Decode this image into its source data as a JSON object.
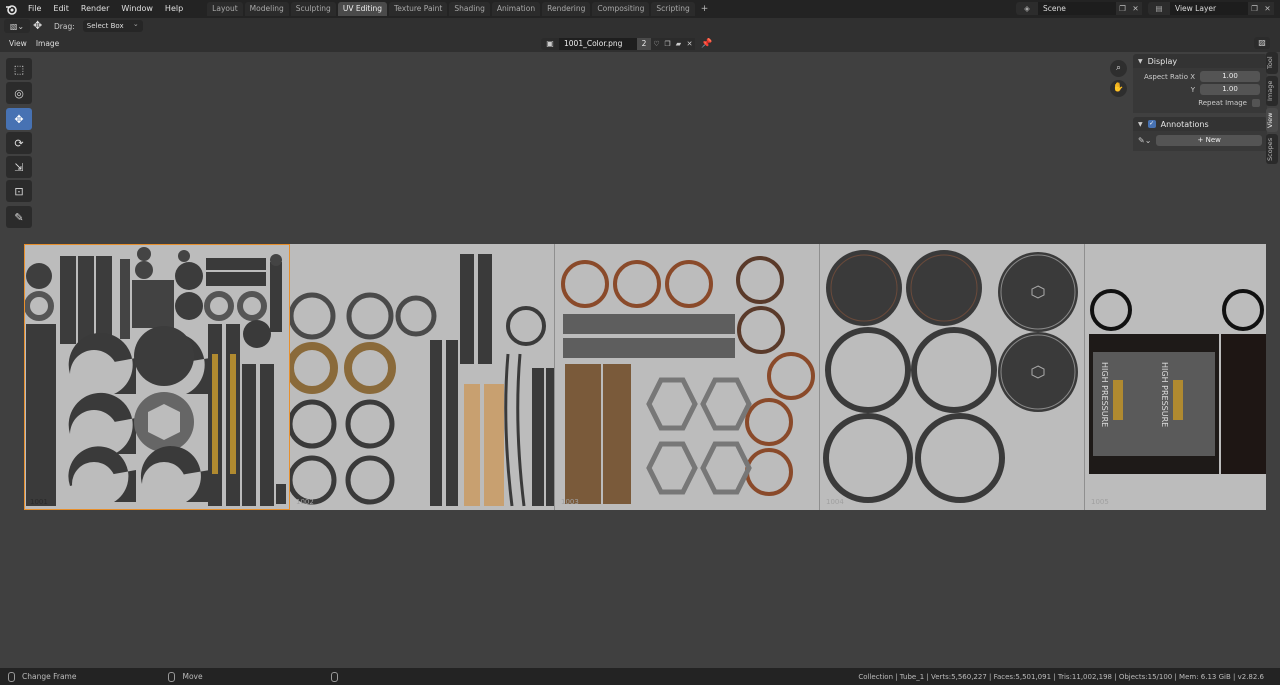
{
  "topbar": {
    "menu": [
      "File",
      "Edit",
      "Render",
      "Window",
      "Help"
    ],
    "workspaces": [
      "Layout",
      "Modeling",
      "Sculpting",
      "UV Editing",
      "Texture Paint",
      "Shading",
      "Animation",
      "Rendering",
      "Compositing",
      "Scripting"
    ],
    "active_workspace": "UV Editing",
    "scene": "Scene",
    "view_layer": "View Layer"
  },
  "header": {
    "drag_label": "Drag:",
    "drag_mode": "Select Box",
    "view_menu": "View",
    "image_menu": "Image",
    "image_name": "1001_Color.png",
    "image_users": "2"
  },
  "npanel": {
    "display": {
      "title": "Display",
      "aspect_x_label": "Aspect Ratio X",
      "aspect_x": "1.00",
      "aspect_y_label": "Y",
      "aspect_y": "1.00",
      "repeat_label": "Repeat Image"
    },
    "annotations": {
      "title": "Annotations",
      "new_label": "New"
    },
    "tabs": [
      "Tool",
      "Image",
      "View",
      "Scopes"
    ],
    "active_tab": "View"
  },
  "uv": {
    "tiles": [
      "1001",
      "1002",
      "1003",
      "1004",
      "1005"
    ]
  },
  "statusbar": {
    "left_action": "Change Frame",
    "mid_action": "Move",
    "stats": "Collection | Tube_1 | Verts:5,560,227 | Faces:5,501,091 | Tris:11,002,198 | Objects:15/100 | Mem: 6.13 GiB | v2.82.6"
  },
  "colors": {
    "accent": "#4772b3",
    "tile_select": "#e78f2c",
    "bg": "#404040"
  }
}
